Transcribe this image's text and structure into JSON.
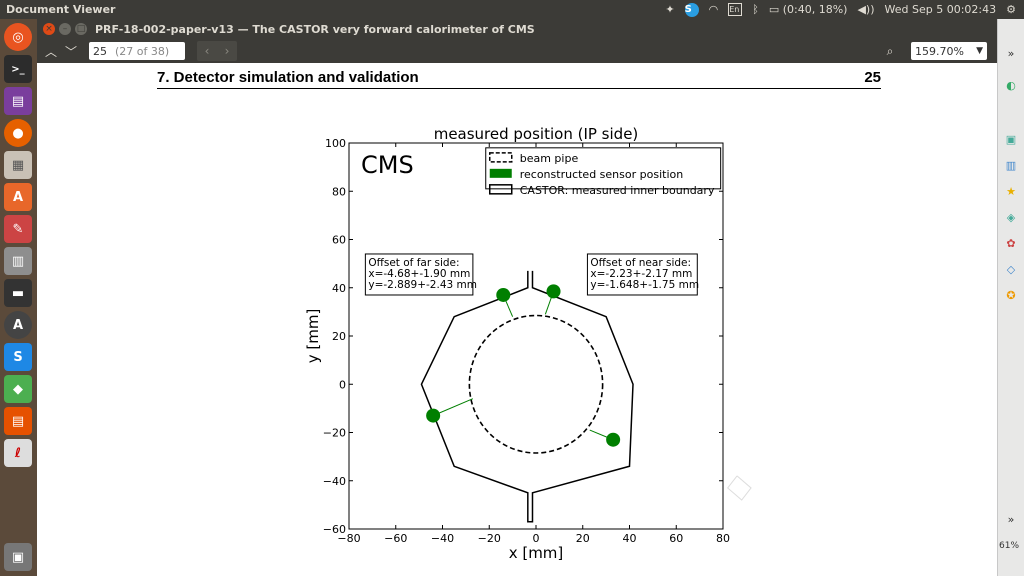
{
  "topbar": {
    "app_title": "Document Viewer",
    "keyboard": "En",
    "battery": "(0:40, 18%)",
    "clock": "Wed Sep  5 00:02:43",
    "skype": "S"
  },
  "window": {
    "title": "PRF-18-002-paper-v13 — The CASTOR very forward calorimeter of CMS"
  },
  "toolbar": {
    "page_value": "25",
    "page_of": "(27 of 38)",
    "zoom": "159.70%"
  },
  "document": {
    "section_title": "7.  Detector simulation and validation",
    "page_number": "25"
  },
  "chart_data": {
    "type": "scatter",
    "title": "measured position (IP side)",
    "xlabel": "x [mm]",
    "ylabel": "y [mm]",
    "xlim": [
      -80,
      80
    ],
    "ylim": [
      -60,
      100
    ],
    "xticks": [
      "−80",
      "−60",
      "−40",
      "−20",
      "0",
      "20",
      "40",
      "60",
      "80"
    ],
    "yticks": [
      "100",
      "80",
      "60",
      "40",
      "20",
      "0",
      "−20",
      "−40",
      "−60"
    ],
    "watermark": "CMS",
    "legend": {
      "placement": "top-right",
      "entries": [
        "beam pipe",
        "reconstructed sensor position",
        "CASTOR: measured inner boundary"
      ]
    },
    "beam_pipe": {
      "center": [
        0,
        0
      ],
      "radius": 28.5
    },
    "boundary_polygon": [
      [
        -3.5,
        47
      ],
      [
        -3.5,
        40
      ],
      [
        -35,
        28
      ],
      [
        -49,
        0
      ],
      [
        -35,
        -34
      ],
      [
        -3.5,
        -45
      ],
      [
        -3.5,
        -57
      ],
      [
        -1.5,
        -57
      ],
      [
        -1.5,
        -45
      ],
      [
        40,
        -34
      ],
      [
        41.5,
        0
      ],
      [
        30,
        28
      ],
      [
        -1.5,
        40
      ],
      [
        -1.5,
        47
      ]
    ],
    "sensors": [
      {
        "x": -14,
        "y": 37,
        "line_to": [
          -10,
          28
        ]
      },
      {
        "x": 7.5,
        "y": 38.5,
        "line_to": [
          4,
          29
        ]
      },
      {
        "x": -44,
        "y": -13,
        "line_to": [
          -27,
          -6
        ]
      },
      {
        "x": 33,
        "y": -23,
        "line_to": [
          23,
          -19
        ]
      }
    ],
    "annotations": [
      {
        "lines": [
          "Offset of far side:",
          "x=-4.68+-1.90 mm",
          "y=-2.889+-2.43 mm"
        ]
      },
      {
        "lines": [
          "Offset of near side:",
          "x=-2.23+-2.17 mm",
          "y=-1.648+-1.75 mm"
        ]
      }
    ],
    "colors": {
      "sensor": "#007f00",
      "line": "#000000"
    }
  },
  "rightpanel": {
    "zoom_percent": "61%"
  }
}
